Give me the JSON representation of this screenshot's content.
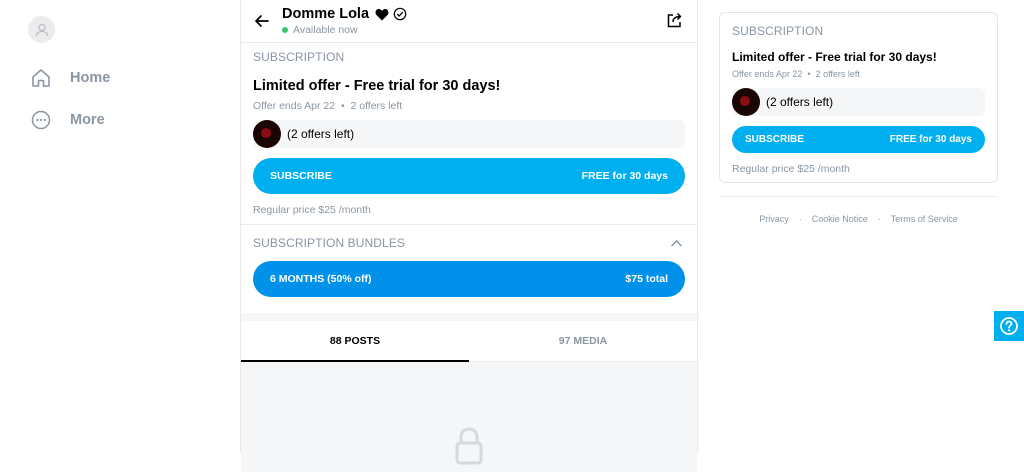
{
  "nav": {
    "items": [
      {
        "label": "Home",
        "icon": "home-icon"
      },
      {
        "label": "More",
        "icon": "more-icon"
      }
    ]
  },
  "profile": {
    "name": "Domme Lola",
    "status": "Available now"
  },
  "subscription": {
    "section_title": "SUBSCRIPTION",
    "offer_title": "Limited offer - Free trial for 30 days!",
    "offer_ends": "Offer ends Apr 22",
    "offers_left_meta": "2 offers left",
    "offers_left_box": "(2 offers left)",
    "subscribe_label": "SUBSCRIBE",
    "subscribe_price": "FREE for 30 days",
    "regular_price": "Regular price $25 /month"
  },
  "bundles": {
    "section_title": "SUBSCRIPTION BUNDLES",
    "items": [
      {
        "label": "6 MONTHS (50% off)",
        "price": "$75 total"
      }
    ]
  },
  "tabs": [
    {
      "label": "88 POSTS",
      "active": true
    },
    {
      "label": "97 MEDIA",
      "active": false
    }
  ],
  "sidebar_card": {
    "section_title": "SUBSCRIPTION",
    "offer_title": "Limited offer - Free trial for 30 days!",
    "offer_ends": "Offer ends Apr 22",
    "offers_left_meta": "2 offers left",
    "offers_left_box": "(2 offers left)",
    "subscribe_label": "SUBSCRIBE",
    "subscribe_price": "FREE for 30 days",
    "regular_price": "Regular price $25 /month"
  },
  "footer": {
    "links": [
      "Privacy",
      "Cookie Notice",
      "Terms of Service"
    ],
    "separator": "·"
  },
  "colors": {
    "accent": "#00aff0",
    "bundle_button": "#0091ea",
    "online": "#39c66b",
    "muted": "#8a96a3"
  }
}
